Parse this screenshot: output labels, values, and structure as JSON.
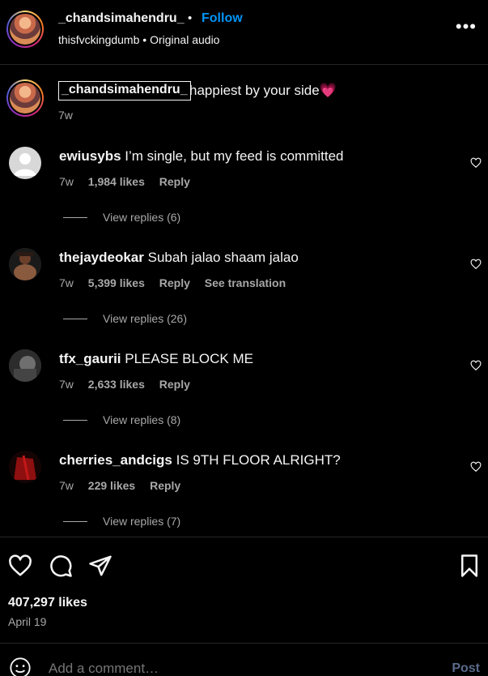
{
  "header": {
    "username": "_chandsimahendru_",
    "separator": "•",
    "follow_label": "Follow",
    "audio_author": "thisfvckingdumb",
    "audio_separator": "•",
    "audio_label": "Original audio",
    "more_label": "•••"
  },
  "caption": {
    "username": "_chandsimahendru_",
    "text": "happiest by your side",
    "emoji": "💗",
    "time": "7w"
  },
  "comments": [
    {
      "username": "ewiusybs",
      "text": "I’m single, but my feed is committed",
      "time": "7w",
      "likes": "1,984 likes",
      "reply_label": "Reply",
      "translation_label": "",
      "view_replies": "View replies (6)"
    },
    {
      "username": "thejaydeokar",
      "text": "Subah jalao shaam jalao",
      "time": "7w",
      "likes": "5,399 likes",
      "reply_label": "Reply",
      "translation_label": "See translation",
      "view_replies": "View replies (26)"
    },
    {
      "username": "tfx_gaurii",
      "text": "PLEASE BLOCK ME",
      "time": "7w",
      "likes": "2,633 likes",
      "reply_label": "Reply",
      "translation_label": "",
      "view_replies": "View replies (8)"
    },
    {
      "username": "cherries_andcigs",
      "text": "IS 9TH FLOOR ALRIGHT?",
      "time": "7w",
      "likes": "229 likes",
      "reply_label": "Reply",
      "translation_label": "",
      "view_replies": "View replies (7)"
    }
  ],
  "post": {
    "likes": "407,297 likes",
    "date": "April 19"
  },
  "add_comment": {
    "placeholder": "Add a comment…",
    "post_label": "Post"
  },
  "icons": {
    "like": "heart-icon",
    "comment": "comment-icon",
    "share": "share-icon",
    "save": "bookmark-icon",
    "emoji": "emoji-icon"
  },
  "colors": {
    "background": "#000000",
    "text": "#f5f5f5",
    "secondary": "#a8a8a8",
    "accent": "#0095f6"
  }
}
